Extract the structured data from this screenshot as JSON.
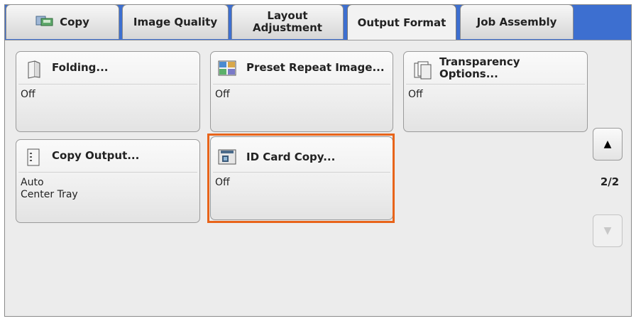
{
  "tabs": [
    {
      "label": "Copy",
      "icon": "copy-icon"
    },
    {
      "label": "Image Quality"
    },
    {
      "label": "Layout\nAdjustment"
    },
    {
      "label": "Output Format",
      "active": true
    },
    {
      "label": "Job Assembly"
    }
  ],
  "buttons": {
    "folding": {
      "title": "Folding...",
      "status": "Off",
      "icon": "folding-icon"
    },
    "preset_repeat": {
      "title": "Preset Repeat Image...",
      "status": "Off",
      "icon": "preset-repeat-icon"
    },
    "transparency": {
      "title": "Transparency\nOptions...",
      "status": "Off",
      "icon": "transparency-icon"
    },
    "copy_output": {
      "title": "Copy Output...",
      "status": "Auto\nCenter Tray",
      "icon": "copy-output-icon"
    },
    "id_card": {
      "title": "ID Card Copy...",
      "status": "Off",
      "icon": "id-card-icon",
      "highlighted": true
    }
  },
  "pager": {
    "indicator": "2/2",
    "up_icon": "triangle-up-icon",
    "down_icon": "triangle-down-icon"
  },
  "colors": {
    "tab_bar": "#3d6fd0",
    "highlight": "#e8641a"
  }
}
